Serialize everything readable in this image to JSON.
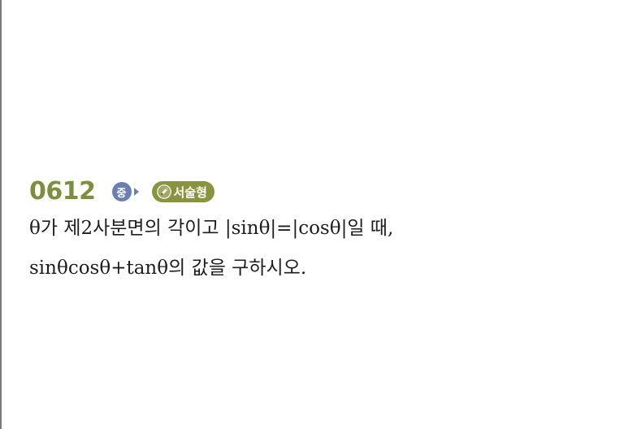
{
  "problem": {
    "number": "0612",
    "difficulty_badge": "중",
    "type_tag": "서술형",
    "text_line_1": "θ가 제2사분면의 각이고 |sinθ|=|cosθ|일 때,",
    "text_line_2": "sinθcosθ+tanθ의 값을 구하시오."
  },
  "icons": {
    "difficulty_arrow": "chevron-right-icon",
    "type_tag_icon": "pencil-icon"
  },
  "colors": {
    "problem_number": "#7c8f3f",
    "difficulty_badge": "#6b7fb3",
    "type_tag": "#8a9440",
    "text": "#1e1e1e"
  }
}
